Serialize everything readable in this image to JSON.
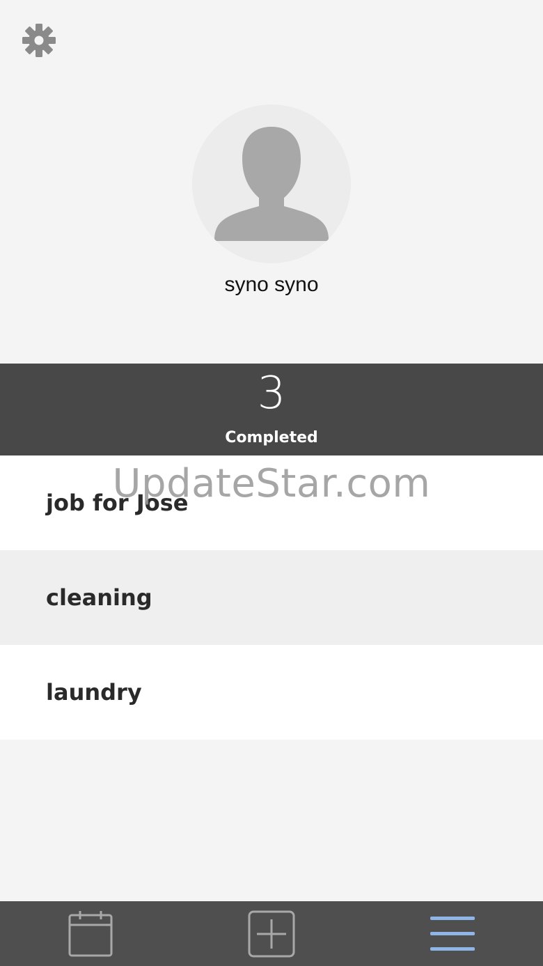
{
  "header": {
    "settings_icon": "gear-icon"
  },
  "profile": {
    "avatar_icon": "user-avatar-icon",
    "name": "syno syno"
  },
  "summary": {
    "count": "3",
    "label": "Completed"
  },
  "tasks": [
    {
      "title": "job for Jose"
    },
    {
      "title": "cleaning"
    },
    {
      "title": "laundry"
    }
  ],
  "watermark": "UpdateStar.com",
  "tabbar": {
    "tabs": [
      {
        "icon": "calendar-icon"
      },
      {
        "icon": "add-icon"
      },
      {
        "icon": "menu-icon",
        "active": true
      }
    ]
  },
  "colors": {
    "background": "#f4f4f4",
    "summary_bar": "#484848",
    "tabbar": "#4f4f4f",
    "active_tab": "#8fb6e6",
    "inactive_tab": "#a8a8a8"
  }
}
